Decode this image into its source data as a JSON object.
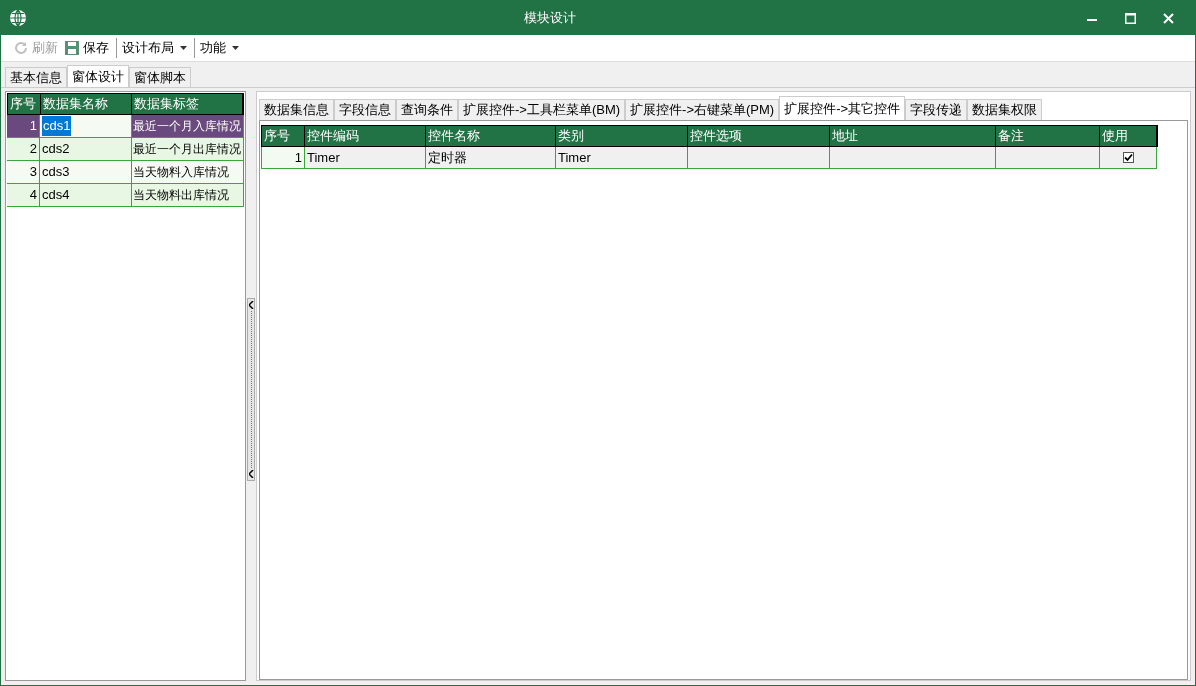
{
  "window": {
    "title": "模块设计"
  },
  "toolbar": [
    {
      "label": "刷新",
      "kind": "refresh",
      "disabled": true,
      "dropdown": false
    },
    {
      "label": "保存",
      "kind": "save",
      "disabled": false,
      "dropdown": false
    },
    {
      "label": "设计布局",
      "kind": "text",
      "disabled": false,
      "dropdown": true
    },
    {
      "label": "功能",
      "kind": "text",
      "disabled": false,
      "dropdown": true
    }
  ],
  "tabs": [
    {
      "label": "基本信息",
      "selected": false
    },
    {
      "label": "窗体设计",
      "selected": true
    },
    {
      "label": "窗体脚本",
      "selected": false
    }
  ],
  "dataset_table": {
    "columns": [
      "序号",
      "数据集名称",
      "数据集标签"
    ],
    "rows": [
      {
        "cells": [
          "1",
          "cds1",
          "最近一个月入库情况"
        ],
        "selected": true
      },
      {
        "cells": [
          "2",
          "cds2",
          "最近一个月出库情况"
        ],
        "selected": false
      },
      {
        "cells": [
          "3",
          "cds3",
          "当天物料入库情况"
        ],
        "selected": false
      },
      {
        "cells": [
          "4",
          "cds4",
          "当天物料出库情况"
        ],
        "selected": false
      }
    ]
  },
  "detail_tabs": [
    {
      "label": "数据集信息",
      "selected": false
    },
    {
      "label": "字段信息",
      "selected": false
    },
    {
      "label": "查询条件",
      "selected": false
    },
    {
      "label": "扩展控件->工具栏菜单(BM)",
      "selected": false
    },
    {
      "label": "扩展控件->右键菜单(PM)",
      "selected": false
    },
    {
      "label": "扩展控件->其它控件",
      "selected": true
    },
    {
      "label": "字段传递",
      "selected": false
    },
    {
      "label": "数据集权限",
      "selected": false
    }
  ],
  "controls_table": {
    "columns": [
      "序号",
      "控件编码",
      "控件名称",
      "类别",
      "控件选项",
      "地址",
      "备注",
      "使用"
    ],
    "rows": [
      {
        "index": "1",
        "code": "Timer",
        "name": "定时器",
        "category": "Timer",
        "checked": true
      }
    ]
  }
}
